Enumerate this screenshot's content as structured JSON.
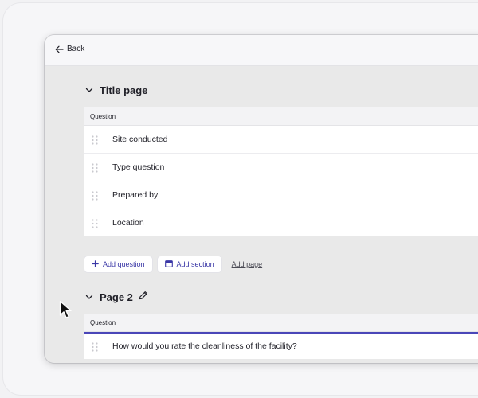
{
  "topbar": {
    "back_label": "Back"
  },
  "page1": {
    "title": "Title page",
    "column_header": "Question",
    "questions": [
      {
        "label": "Site conducted"
      },
      {
        "label": "Type question"
      },
      {
        "label": "Prepared by"
      },
      {
        "label": "Location"
      }
    ]
  },
  "actions": {
    "add_question": "Add question",
    "add_section": "Add section",
    "add_page": "Add page"
  },
  "page2": {
    "title": "Page 2",
    "column_header": "Question",
    "questions": [
      {
        "label": "How would you rate the cleanliness of the facility?"
      }
    ]
  },
  "colors": {
    "accent": "#3a37a6",
    "selection_border": "#4a46b8",
    "canvas": "#e9e9e9"
  },
  "icons": [
    "arrow-left-icon",
    "chevron-down-icon",
    "drag-handle-icon",
    "plus-icon",
    "section-icon",
    "pencil-icon",
    "mouse-pointer-icon"
  ]
}
